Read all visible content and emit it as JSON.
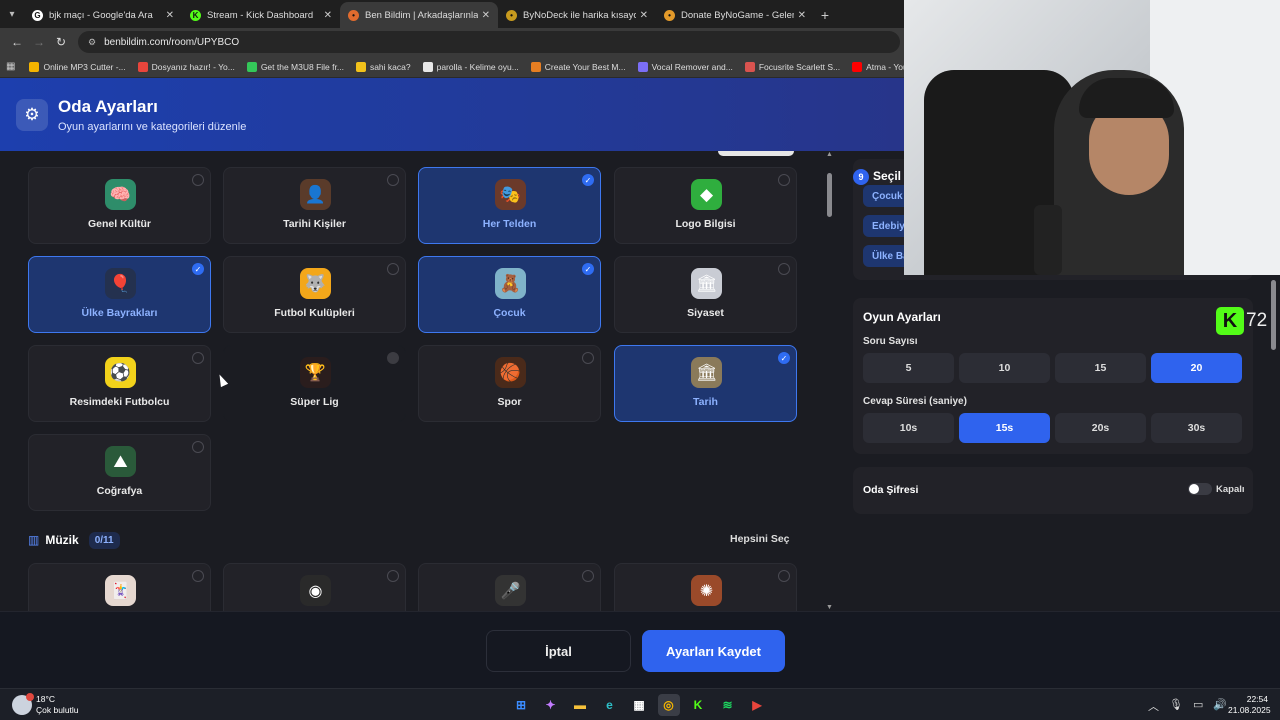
{
  "browser": {
    "tabs": [
      {
        "title": "bjk maçı - Google'da Ara",
        "favicon_color": "#ffffff",
        "glyph": "G"
      },
      {
        "title": "Stream - Kick Dashboard",
        "favicon_color": "#53fc18",
        "glyph": "K"
      },
      {
        "title": "Ben Bildim | Arkadaşlarınla Onl",
        "favicon_color": "#e06b2e",
        "glyph": "•"
      },
      {
        "title": "ByNoDeck ile harika kısayollar y",
        "favicon_color": "#c79a1e",
        "glyph": "•"
      },
      {
        "title": "Donate ByNoGame - Gelen/Gid",
        "favicon_color": "#e39a2a",
        "glyph": "•"
      }
    ],
    "url": "benbildim.com/room/UPYBCO",
    "bookmarks": [
      {
        "label": "Online MP3 Cutter -...",
        "color": "#f4b400"
      },
      {
        "label": "Dosyanız hazır! - Yo...",
        "color": "#e8453c"
      },
      {
        "label": "Get the M3U8 File fr...",
        "color": "#34c759"
      },
      {
        "label": "sahi kaca?",
        "color": "#f2c21b"
      },
      {
        "label": "parolla - Kelime oyu...",
        "color": "#e8e8e8"
      },
      {
        "label": "Create Your Best M...",
        "color": "#e67e22"
      },
      {
        "label": "Vocal Remover and...",
        "color": "#7b6ef6"
      },
      {
        "label": "Focusrite Scarlett S...",
        "color": "#d9534f"
      },
      {
        "label": "Atma - YouTube",
        "color": "#ff0000"
      }
    ]
  },
  "header": {
    "title": "Oda Ayarları",
    "subtitle": "Oyun ayarlarını ve kategorileri düzenle"
  },
  "categories": [
    {
      "label": "Genel Kültür",
      "icon": "brain-icon",
      "glyph": "🧠",
      "bg": "#2e8d6a",
      "selected": false
    },
    {
      "label": "Tarihi Kişiler",
      "icon": "portrait-icon",
      "glyph": "👤",
      "bg": "#5a3b2a",
      "selected": false
    },
    {
      "label": "Her Telden",
      "icon": "people-icon",
      "glyph": "🎭",
      "bg": "#6b3a2a",
      "selected": true
    },
    {
      "label": "Logo Bilgisi",
      "icon": "logo-icon",
      "glyph": "◆",
      "bg": "#2fae3e",
      "selected": false
    },
    {
      "label": "Ülke Bayrakları",
      "icon": "flag-icon",
      "glyph": "🎈",
      "bg": "#24314f",
      "selected": true
    },
    {
      "label": "Futbol Kulüpleri",
      "icon": "wolf-crest-icon",
      "glyph": "🐺",
      "bg": "#f3a71a",
      "selected": false
    },
    {
      "label": "Çocuk",
      "icon": "child-icon",
      "glyph": "🧸",
      "bg": "#7fb3c9",
      "selected": true
    },
    {
      "label": "Siyaset",
      "icon": "parliament-icon",
      "glyph": "🏛",
      "bg": "#c9ccd4",
      "selected": false
    },
    {
      "label": "Resimdeki Futbolcu",
      "icon": "footballer-icon",
      "glyph": "⚽",
      "bg": "#f2d21b",
      "selected": false
    },
    {
      "label": "Süper Lig",
      "icon": "trophy-icon",
      "glyph": "🏆",
      "bg": "#2a1d1d",
      "selected": false
    },
    {
      "label": "Spor",
      "icon": "ball-icon",
      "glyph": "🏀",
      "bg": "#4a2a1a",
      "selected": false
    },
    {
      "label": "Tarih",
      "icon": "colosseum-icon",
      "glyph": "🏛",
      "bg": "#8a7a5a",
      "selected": true
    },
    {
      "label": "Coğrafya",
      "icon": "mountain-icon",
      "glyph": "⛰",
      "bg": "#2a5a3a",
      "selected": false
    }
  ],
  "music": {
    "title": "Müzik",
    "count": "0/11",
    "select_all": "Hepsini Seç",
    "items": [
      {
        "icon": "cards-icon",
        "glyph": "🃏",
        "bg": "#e6d8d0"
      },
      {
        "icon": "vinyl-icon",
        "glyph": "◉",
        "bg": "#2a2a2a"
      },
      {
        "icon": "microphone-icon",
        "glyph": "🎤",
        "bg": "#333333"
      },
      {
        "icon": "emblem-icon",
        "glyph": "✺",
        "bg": "#9a4a2a"
      }
    ]
  },
  "selected_panel": {
    "count": "9",
    "title": "Seçil",
    "chips": [
      "Çocuk",
      "Edebiy",
      "Ülke Ba"
    ]
  },
  "settings": {
    "title": "Oyun Ayarları",
    "question_label": "Soru Sayısı",
    "question_options": [
      "5",
      "10",
      "15",
      "20"
    ],
    "question_selected": "20",
    "time_label": "Cevap Süresi (saniye)",
    "time_options": [
      "10s",
      "15s",
      "20s",
      "30s"
    ],
    "time_selected": "15s",
    "password_label": "Oda Şifresi",
    "password_state": "Kapalı"
  },
  "kick": {
    "viewers": "72",
    "glyph": "K"
  },
  "footer": {
    "cancel": "İptal",
    "save": "Ayarları Kaydet"
  },
  "taskbar": {
    "weather_temp": "18°C",
    "weather_desc": "Çok bulutlu",
    "time": "22:54",
    "date": "21.08.2025",
    "apps": [
      {
        "icon": "windows-start-icon",
        "glyph": "⊞",
        "color": "#3b8cff"
      },
      {
        "icon": "copilot-icon",
        "glyph": "✦",
        "color": "#c27bff"
      },
      {
        "icon": "file-explorer-icon",
        "glyph": "▬",
        "color": "#f5c13b"
      },
      {
        "icon": "edge-icon",
        "glyph": "e",
        "color": "#2dc0c8"
      },
      {
        "icon": "store-icon",
        "glyph": "▦",
        "color": "#ffffff"
      },
      {
        "icon": "chrome-icon",
        "glyph": "◎",
        "color": "#f4b400"
      },
      {
        "icon": "kick-app-icon",
        "glyph": "K",
        "color": "#53fc18"
      },
      {
        "icon": "spotify-icon",
        "glyph": "≋",
        "color": "#1ed760"
      },
      {
        "icon": "player-icon",
        "glyph": "▶",
        "color": "#e8453c"
      }
    ]
  }
}
